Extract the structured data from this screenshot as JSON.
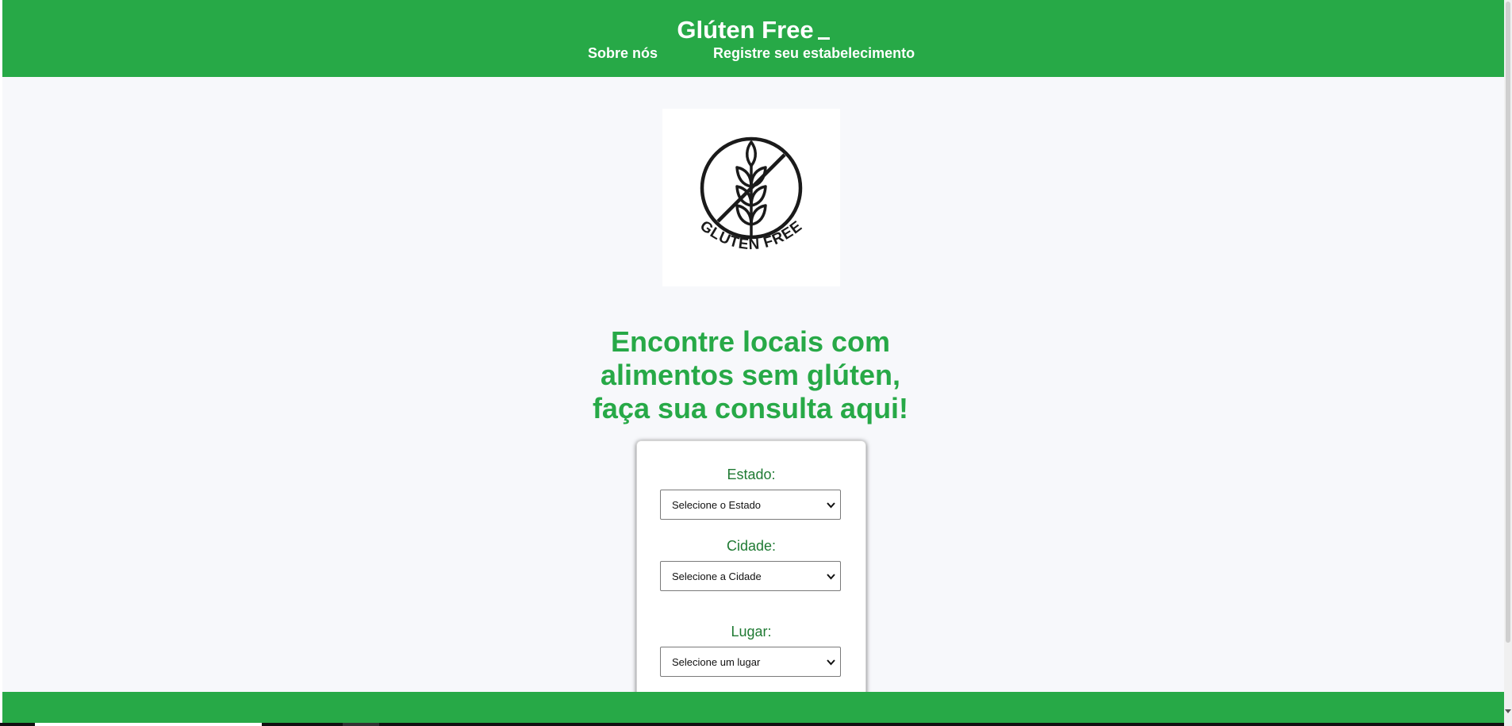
{
  "header": {
    "brand": "Glúten Free",
    "nav": {
      "about": "Sobre nós",
      "register": "Registre seu estabelecimento"
    }
  },
  "logo": {
    "text": "GLUTEN FREE",
    "icon": "wheat-crossed-out-icon"
  },
  "hero": {
    "line1": "Encontre locais com",
    "line2": "alimentos sem glúten,",
    "line3": "faça sua consulta aqui!"
  },
  "form": {
    "state_label": "Estado:",
    "state_value": "Selecione o Estado",
    "city_label": "Cidade:",
    "city_value": "Selecione a Cidade",
    "place_label": "Lugar:",
    "place_value": "Selecione um lugar"
  },
  "colors": {
    "brand_green": "#27a947",
    "label_green": "#1f7a33",
    "page_background": "#f7f8fb"
  }
}
